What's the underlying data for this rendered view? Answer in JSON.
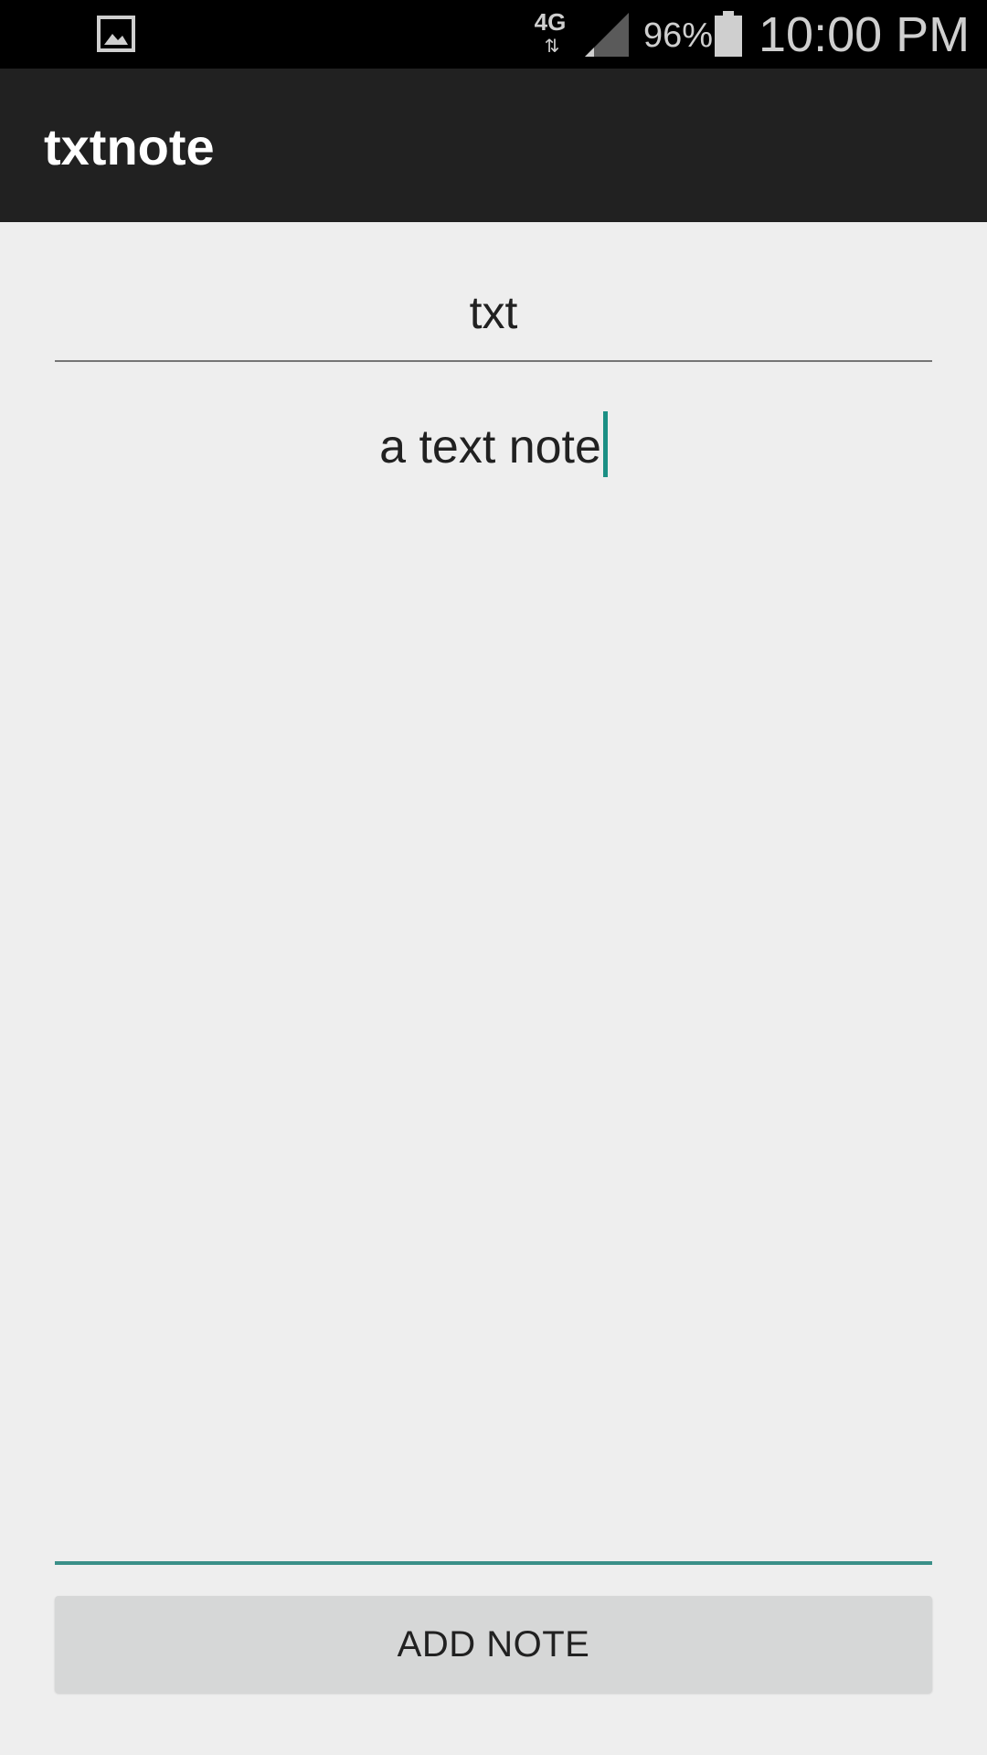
{
  "status_bar": {
    "network": "4G",
    "network_arrows": "⇅",
    "battery_percent": "96%",
    "time": "10:00 PM",
    "icons": [
      "gallery-icon",
      "signal-icon",
      "battery-icon"
    ]
  },
  "app_bar": {
    "title": "txtnote"
  },
  "form": {
    "title_value": "txt",
    "note_value": "a text note",
    "add_button_label": "ADD NOTE"
  },
  "colors": {
    "status_bar_bg": "#000000",
    "app_bar_bg": "#212121",
    "page_bg": "#eeeeee",
    "accent": "#1b8f84",
    "button_bg": "#d6d7d7"
  }
}
